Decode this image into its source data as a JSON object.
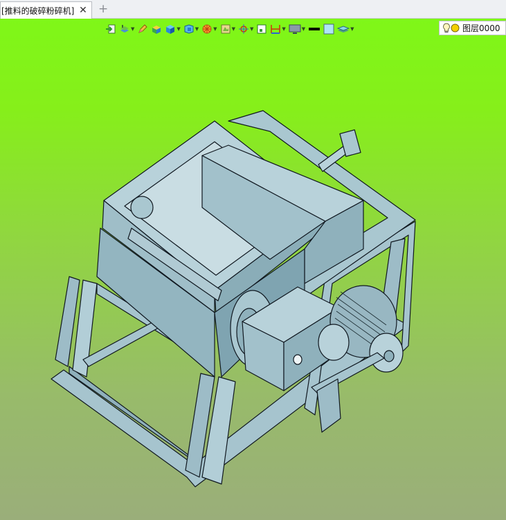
{
  "tab": {
    "title": "[推料的破碎粉碎机]",
    "close_glyph": "✕",
    "add_glyph": "+"
  },
  "toolbar": {
    "icons": [
      "exit-sketch-icon",
      "layers-icon",
      "pencil-icon",
      "box-solid-icon",
      "cube-view-icon",
      "view-orient-icon",
      "section-icon",
      "render-style-icon",
      "origin-icon",
      "fit-view-icon",
      "dimension-icon",
      "display-icon",
      "line-color-icon",
      "fill-color-icon",
      "layer-stack-icon",
      "light-bulb-icon"
    ],
    "colors": {
      "line_swatch": "#000000",
      "fill_swatch": "#aee6f5"
    }
  },
  "layer": {
    "name": "图层0000",
    "status_color": "#f4d000"
  },
  "viewport": {
    "background_top": "#7ff718",
    "background_bottom": "#9aae7a",
    "model_color": "#a9c7d0"
  }
}
